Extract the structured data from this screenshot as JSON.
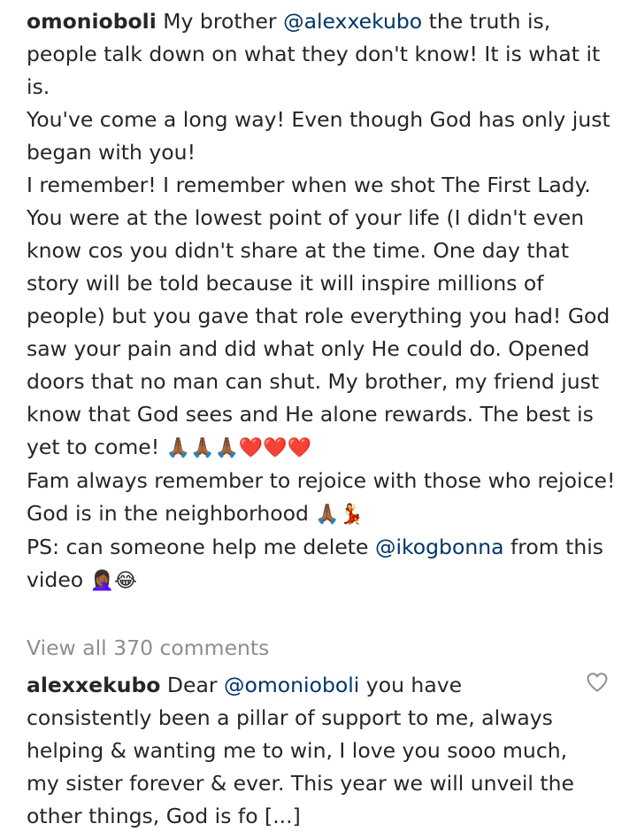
{
  "post": {
    "username": "omonioboli",
    "caption": [
      [
        {
          "t": "text",
          "v": " My brother "
        },
        {
          "t": "mention",
          "v": "@alexxekubo"
        },
        {
          "t": "text",
          "v": " the truth is, people talk down on what they don't know! It is what it is."
        }
      ],
      [
        {
          "t": "text",
          "v": "You've come a long way! Even though God has only just began with you!"
        }
      ],
      [
        {
          "t": "text",
          "v": "I remember! I remember when we shot The First Lady. You were at the lowest point of your life (I didn't even know cos you didn't share at the time. One day that story will be told because it will inspire millions of people) but you gave that role everything you had! God saw your pain and did what only He could do. Opened doors that no man can shut. My brother, my friend just know that God sees and He alone rewards. The best is yet to come! "
        },
        {
          "t": "emoji",
          "v": "🙏🏾🙏🏾🙏🏾❤️❤️❤️"
        }
      ],
      [
        {
          "t": "text",
          "v": "Fam always remember to rejoice with those who rejoice! God is in the neighborhood "
        },
        {
          "t": "emoji",
          "v": "🙏🏾💃"
        }
      ],
      [
        {
          "t": "text",
          "v": "PS: can someone help me delete "
        },
        {
          "t": "mention",
          "v": "@ikogbonna"
        },
        {
          "t": "text",
          "v": " from this video "
        },
        {
          "t": "emoji",
          "v": "🤦🏾‍♀️😂"
        }
      ]
    ]
  },
  "view_all_comments": "View all 370 comments",
  "comment": {
    "username": "alexxekubo",
    "pre": " Dear ",
    "mention": "@omonioboli",
    "text": " you have consistently been a pillar of support to me, always helping & wanting me to win, I love you sooo much, my sister forever & ever. This year we will unveil the other things, God is fo [...]",
    "like_icon": "heart-outline-icon"
  }
}
